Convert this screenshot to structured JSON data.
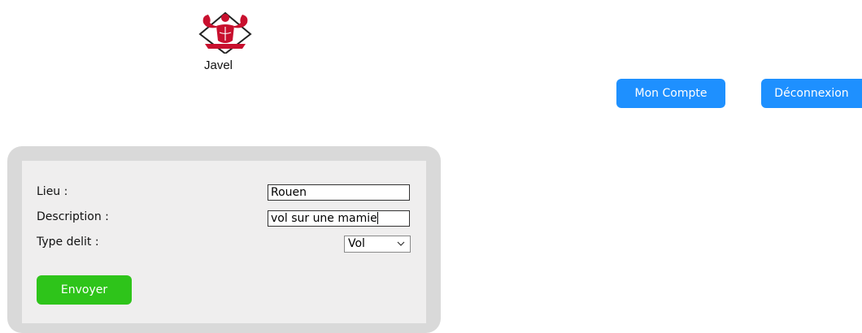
{
  "header": {
    "brand_name": "Javel",
    "logo_icon": "bodybuilder-logo-icon"
  },
  "nav": {
    "account_label": "Mon Compte",
    "logout_label": "Déconnexion"
  },
  "form": {
    "lieu_label": "Lieu :",
    "lieu_value": "Rouen",
    "description_label": "Description :",
    "description_value": "vol sur une mamie",
    "type_label": "Type delit :",
    "type_selected": "Vol",
    "submit_label": "Envoyer"
  },
  "colors": {
    "primary_button": "#1e90ff",
    "submit_button": "#2ec41a",
    "panel_border": "#d9d9d9",
    "panel_bg": "#efeeee"
  }
}
